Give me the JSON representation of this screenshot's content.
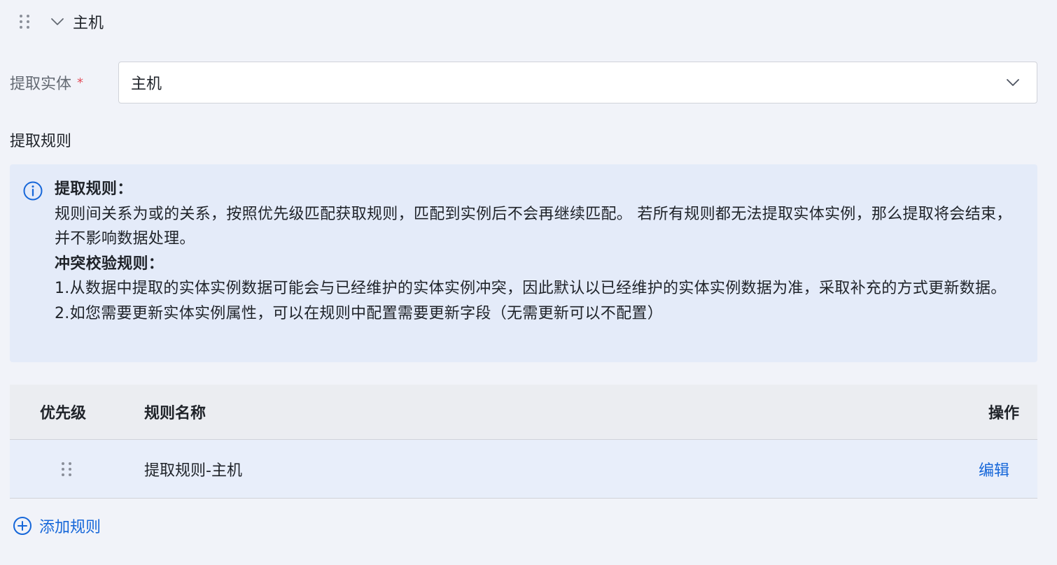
{
  "section": {
    "title": "主机"
  },
  "form": {
    "entity_label": "提取实体",
    "required_mark": "*",
    "entity_value": "主机"
  },
  "rules": {
    "label": "提取规则"
  },
  "alert": {
    "heading1": "提取规则：",
    "text1": "规则间关系为或的关系，按照优先级匹配获取规则，匹配到实例后不会再继续匹配。 若所有规则都无法提取实体实例，那么提取将会结束，并不影响数据处理。",
    "heading2": "冲突校验规则：",
    "text2": "1.从数据中提取的实体实例数据可能会与已经维护的实体实例冲突，因此默认以已经维护的实体实例数据为准，采取补充的方式更新数据。",
    "text3": "2.如您需要更新实体实例属性，可以在规则中配置需要更新字段（无需更新可以不配置）"
  },
  "table": {
    "columns": {
      "priority": "优先级",
      "name": "规则名称",
      "action": "操作"
    },
    "rows": [
      {
        "name": "提取规则-主机",
        "action": "编辑"
      }
    ]
  },
  "add_rule": {
    "label": "添加规则"
  },
  "colors": {
    "background": "#f1f3f9",
    "alert_bg": "#e4ebf9",
    "link": "#1667d9",
    "required": "#e34d59"
  }
}
